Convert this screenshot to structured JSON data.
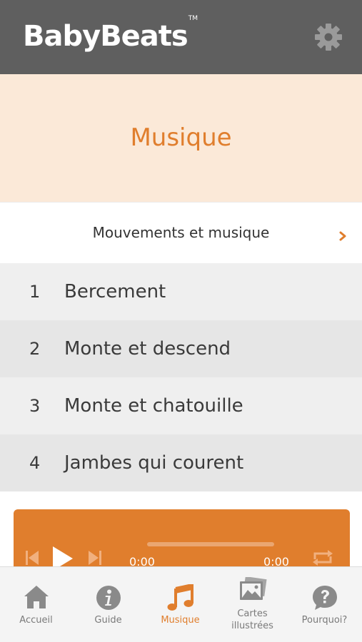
{
  "header": {
    "brand": "BabyBeats",
    "trademark": "TM"
  },
  "hero": {
    "title": "Musique"
  },
  "section": {
    "label": "Mouvements et musique"
  },
  "tracks": [
    {
      "number": "1",
      "title": "Bercement"
    },
    {
      "number": "2",
      "title": "Monte et descend"
    },
    {
      "number": "3",
      "title": "Monte et chatouille"
    },
    {
      "number": "4",
      "title": "Jambes qui courent"
    }
  ],
  "player": {
    "elapsed": "0:00",
    "duration": "0:00",
    "progress": 0
  },
  "tabs": [
    {
      "label": "Accueil",
      "icon": "home-icon",
      "active": false
    },
    {
      "label": "Guide",
      "icon": "info-icon",
      "active": false
    },
    {
      "label": "Musique",
      "icon": "music-note-icon",
      "active": true
    },
    {
      "label": "Cartes illustrées",
      "icon": "picture-icon",
      "active": false
    },
    {
      "label": "Pourquoi?",
      "icon": "question-bubble-icon",
      "active": false
    }
  ],
  "colors": {
    "accent": "#e07e2d",
    "header_bg": "#5f5f5f",
    "hero_bg": "#fbe9d8"
  }
}
